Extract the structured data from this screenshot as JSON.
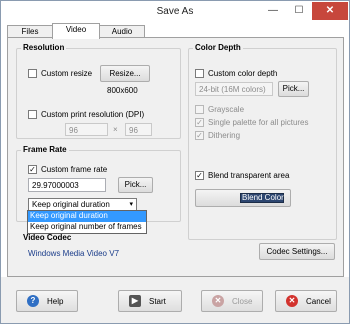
{
  "window": {
    "title": "Save As",
    "min_glyph": "—",
    "max_glyph": "☐",
    "close_glyph": "✕"
  },
  "tabs": [
    {
      "label": "Files"
    },
    {
      "label": "Video"
    },
    {
      "label": "Audio"
    }
  ],
  "resolution": {
    "title": "Resolution",
    "custom_resize_label": "Custom resize",
    "resize_button": "Resize...",
    "resize_value": "800x600",
    "custom_print_label": "Custom print resolution (DPI)",
    "dpi_x": "96",
    "dpi_sep": "×",
    "dpi_y": "96"
  },
  "color_depth": {
    "title": "Color Depth",
    "custom_label": "Custom color depth",
    "depth_value": "24-bit (16M colors)",
    "pick_button": "Pick...",
    "grayscale_label": "Grayscale",
    "single_palette_label": "Single palette for all pictures",
    "dithering_label": "Dithering",
    "blend_label": "Blend transparent area",
    "blend_button": "Blend Color",
    "blend_color": "#2d4670"
  },
  "frame_rate": {
    "title": "Frame Rate",
    "custom_label": "Custom frame rate",
    "rate_value": "29.97000003",
    "pick_button": "Pick...",
    "duration_selected": "Keep original duration",
    "duration_options": [
      "Keep original duration",
      "Keep original number of frames"
    ]
  },
  "video_codec": {
    "title": "Video Codec",
    "codec_name": "Windows Media Video V7",
    "settings_button": "Codec Settings..."
  },
  "footer": {
    "help": "Help",
    "start": "Start",
    "close": "Close",
    "cancel": "Cancel"
  },
  "colors": {
    "accent": "#3399ff",
    "link": "#1a3c8a",
    "close_titlebar": "#c7473c"
  }
}
